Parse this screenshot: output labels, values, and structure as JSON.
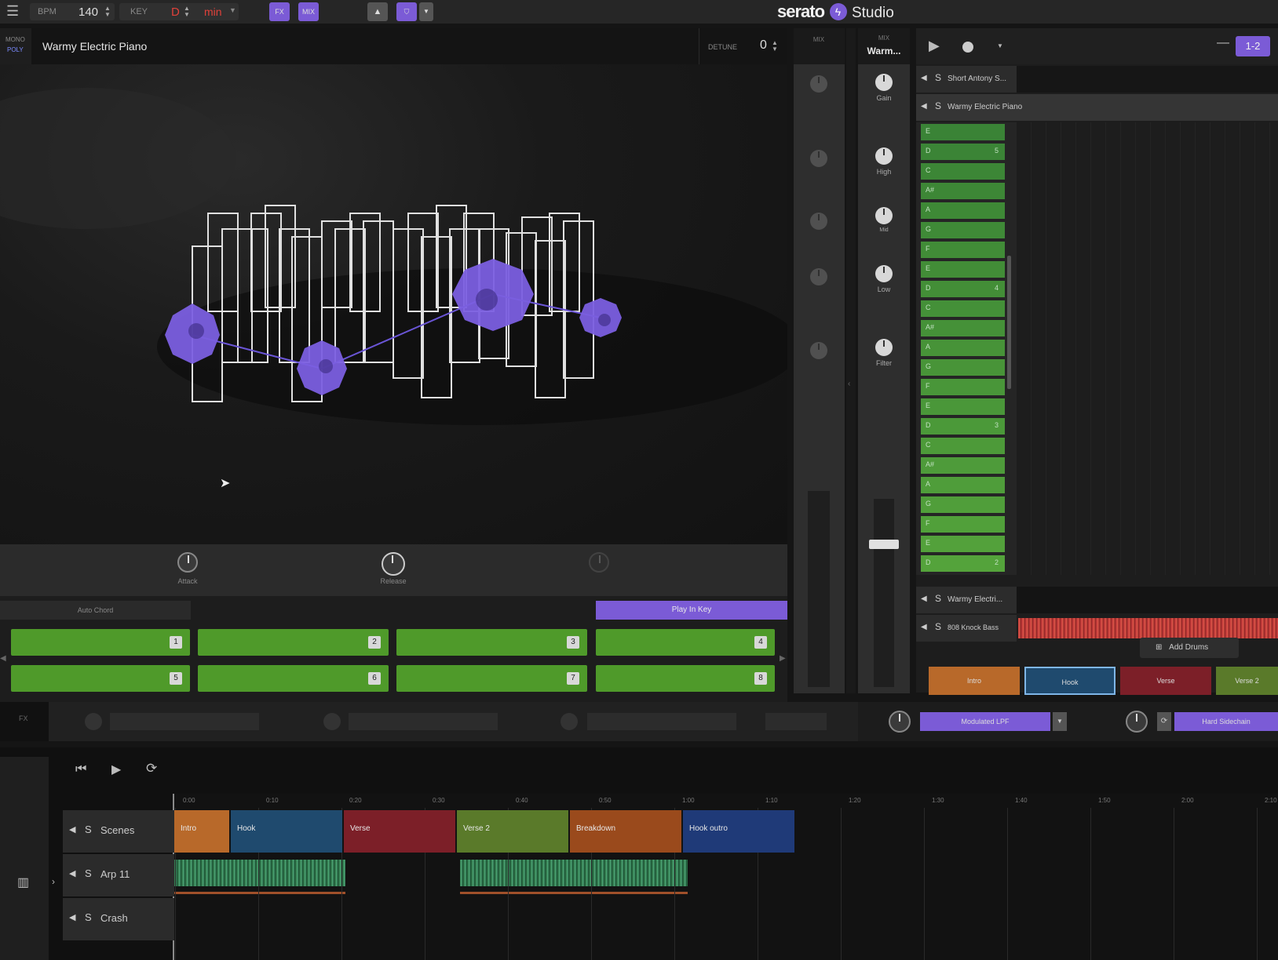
{
  "topbar": {
    "bpm_label": "BPM",
    "bpm_value": "140",
    "key_label": "KEY",
    "key_value": "D",
    "key_mode": "min",
    "fx_btn": "FX",
    "mix_btn": "MIX",
    "brand": "serato",
    "brand_product": "Studio"
  },
  "instrument": {
    "mode_mono": "MONO",
    "mode_poly": "POLY",
    "name": "Warmy Electric Piano",
    "detune_label": "DETUNE",
    "detune_value": "0",
    "knobs": [
      "Attack",
      "Release"
    ],
    "auto_chord": "Auto Chord",
    "play_in_key": "Play In Key",
    "pads": [
      "1",
      "2",
      "3",
      "4",
      "5",
      "6",
      "7",
      "8"
    ]
  },
  "mixer": {
    "strip1_label": "MIX",
    "strip2_label": "MIX",
    "strip2_name": "Warm...",
    "knobs": [
      "Gain",
      "High",
      "Mid",
      "Low",
      "Filter"
    ]
  },
  "song": {
    "channel": "1-2",
    "tracks_top": [
      "Short Antony S...",
      "Warmy Electric Piano"
    ],
    "tracks_bottom": [
      "Warmy Electri...",
      "808 Knock Bass"
    ],
    "keys": [
      {
        "note": "E",
        "num": ""
      },
      {
        "note": "D",
        "num": "5"
      },
      {
        "note": "C",
        "num": ""
      },
      {
        "note": "A#",
        "num": ""
      },
      {
        "note": "A",
        "num": ""
      },
      {
        "note": "G",
        "num": ""
      },
      {
        "note": "F",
        "num": ""
      },
      {
        "note": "E",
        "num": ""
      },
      {
        "note": "D",
        "num": "4"
      },
      {
        "note": "C",
        "num": ""
      },
      {
        "note": "A#",
        "num": ""
      },
      {
        "note": "A",
        "num": ""
      },
      {
        "note": "G",
        "num": ""
      },
      {
        "note": "F",
        "num": ""
      },
      {
        "note": "E",
        "num": ""
      },
      {
        "note": "D",
        "num": "3"
      },
      {
        "note": "C",
        "num": ""
      },
      {
        "note": "A#",
        "num": ""
      },
      {
        "note": "A",
        "num": ""
      },
      {
        "note": "G",
        "num": ""
      },
      {
        "note": "F",
        "num": ""
      },
      {
        "note": "E",
        "num": ""
      },
      {
        "note": "D",
        "num": "2"
      }
    ],
    "add_drums": "Add Drums",
    "scenes": [
      "Intro",
      "Hook",
      "Verse",
      "Verse 2"
    ]
  },
  "fx": {
    "label": "FX",
    "effect1": "Modulated LPF",
    "effect2": "Hard Sidechain"
  },
  "arrange": {
    "tracks": [
      "Scenes",
      "Arp 11",
      "Crash"
    ],
    "ticks": [
      "0:00",
      "0:10",
      "0:20",
      "0:30",
      "0:40",
      "0:50",
      "1:00",
      "1:10",
      "1:20",
      "1:30",
      "1:40",
      "1:50",
      "2:00",
      "2:10"
    ],
    "scenes": [
      {
        "label": "Intro",
        "color": "#b8692a"
      },
      {
        "label": "Hook",
        "color": "#1f4a6e"
      },
      {
        "label": "Verse",
        "color": "#7c1f28"
      },
      {
        "label": "Verse 2",
        "color": "#5a7a2a"
      },
      {
        "label": "Breakdown",
        "color": "#9a4a1c"
      },
      {
        "label": "Hook outro",
        "color": "#1f3a78"
      }
    ]
  },
  "colors": {
    "accent": "#7b5bd6",
    "pad_green": "#4f9a2a",
    "key_green": "#3f8a3f"
  }
}
